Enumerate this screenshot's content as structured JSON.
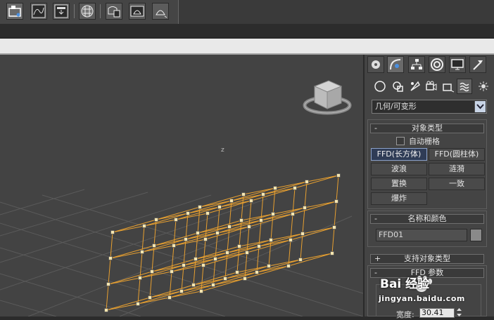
{
  "toolbar": {
    "buttons": [
      {
        "icon": "schematic-view-icon",
        "active": true
      },
      {
        "icon": "curve-editor-icon"
      },
      {
        "icon": "render-setup-icon"
      },
      {
        "icon": "material-editor-icon"
      },
      {
        "icon": "rendered-frame-window-icon"
      },
      {
        "icon": "render-production-icon"
      },
      {
        "icon": "render-iterative-icon"
      }
    ]
  },
  "panel": {
    "tabs": [
      "create-tab-icon",
      "modify-tab-icon",
      "hierarchy-tab-icon",
      "motion-tab-icon",
      "display-tab-icon",
      "utilities-tab-icon"
    ],
    "subtabs": [
      "geometry-icon",
      "shapes-icon",
      "lights-icon",
      "cameras-icon",
      "helpers-icon",
      "space-warps-icon",
      "systems-icon"
    ],
    "category_dropdown": "几何/可变形",
    "object_type": {
      "title": "对象类型",
      "autogrid_label": "自动栅格",
      "buttons": [
        {
          "label": "FFD(长方体)",
          "active": true
        },
        {
          "label": "FFD(圆柱体)"
        },
        {
          "label": "波浪"
        },
        {
          "label": "涟漪"
        },
        {
          "label": "置换"
        },
        {
          "label": "一致"
        },
        {
          "label": "爆炸"
        }
      ]
    },
    "name_color": {
      "title": "名称和颜色",
      "name_value": "FFD01",
      "color": "#8a8a8a"
    },
    "supported_types": {
      "title": "支持对象类型"
    },
    "ffd_params": {
      "title": "FFD 参数",
      "width_label": "宽度:",
      "width_value": "30.41"
    }
  },
  "viewport": {
    "axis_label": "z",
    "lattice_color": "#e8a030"
  },
  "watermark": {
    "brand": "Bai 经验",
    "url": "jingyan.baidu.com"
  }
}
